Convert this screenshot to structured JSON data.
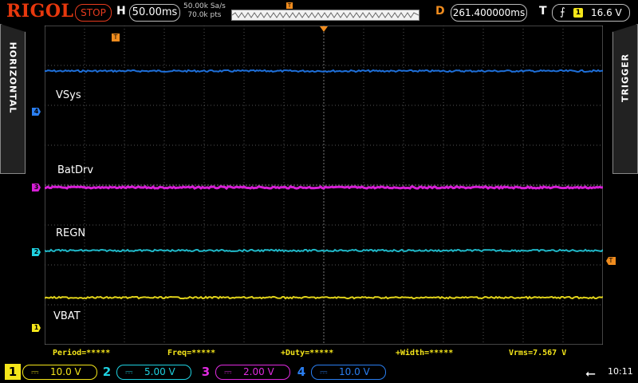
{
  "header": {
    "brand": "RIGOL",
    "run_state": "STOP",
    "h_label": "H",
    "timebase": "50.00ms",
    "sample_rate": "50.00k Sa/s",
    "points": "70.0k pts",
    "d_label": "D",
    "delay": "261.400000ms",
    "t_label": "T",
    "trigger_edge": "⨍",
    "trigger_source": "1",
    "trigger_level": "16.6 V",
    "trigger_marker": "T"
  },
  "side": {
    "left_tab": "HORIZONTAL",
    "right_tab": "TRIGGER"
  },
  "traces": [
    {
      "channel": "4",
      "label": "VSys",
      "color": "#1e6fd9"
    },
    {
      "channel": "3",
      "label": "BatDrv",
      "color": "#d61fd6"
    },
    {
      "channel": "2",
      "label": "REGN",
      "color": "#1fb8c8"
    },
    {
      "channel": "1",
      "label": "VBAT",
      "color": "#e0d21a"
    }
  ],
  "measurements": {
    "period": "Period=*****",
    "freq": "Freq=*****",
    "duty": "+Duty=*****",
    "width": "+Width=*****",
    "vrms": "Vrms=7.567 V"
  },
  "channels": [
    {
      "num": "1",
      "coupling": "⎓",
      "scale": "10.0 V",
      "color": "#f5e61a"
    },
    {
      "num": "2",
      "coupling": "⎓",
      "scale": "5.00 V",
      "color": "#1fd1e0"
    },
    {
      "num": "3",
      "coupling": "⎓",
      "scale": "2.00 V",
      "color": "#e02be0"
    },
    {
      "num": "4",
      "coupling": "⎓",
      "scale": "10.0 V",
      "color": "#2a7ef0"
    }
  ],
  "status": {
    "usb_icon": "usb-icon",
    "clock": "10:11"
  }
}
